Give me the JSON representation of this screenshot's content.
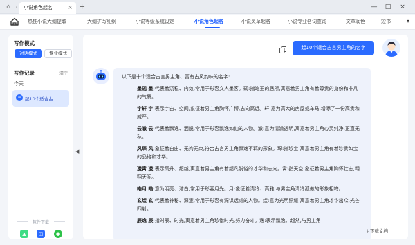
{
  "titlebar": {
    "tab_title": "小说角色起名",
    "close_symbol": "×",
    "plus_symbol": "+"
  },
  "window_controls": {
    "minimize": "—",
    "maximize": "□",
    "close": "×"
  },
  "nav": {
    "items": [
      {
        "label": "热梗小说大纲提取"
      },
      {
        "label": "大纲扩写细纲"
      },
      {
        "label": "小说等级系统设定"
      },
      {
        "label": "小说角色起名"
      },
      {
        "label": "小说灵草起名"
      },
      {
        "label": "小说专业名词查询"
      },
      {
        "label": "文章润色"
      },
      {
        "label": "短书"
      }
    ],
    "active_index": 3,
    "more_symbol": "▾"
  },
  "sidebar": {
    "mode_title": "写作模式",
    "mode_chat": "对话模式",
    "mode_pro": "专业模式",
    "record_title": "写作记录",
    "clear_label": "清空",
    "today_label": "今天",
    "records": [
      {
        "label": "起10个适合古..."
      }
    ],
    "download_label": "软件下载",
    "os_icons": [
      "android-icon",
      "windows-icon",
      "apple-icon"
    ]
  },
  "main": {
    "user_prompt": "起10个适合古言男主角的名字",
    "intro": "以下是十个适合古言男主角、富有古风韵味的名字:",
    "names": [
      {
        "name": "墨砚 墨",
        "desc": ":代表着沉稳、内敛,常用于形容文人墨客。砚:指笔王的居所,寓意着男主角有着尊贵的身份和非凡的气质。"
      },
      {
        "name": "宇轩 宇",
        "desc": ":表示宇宙、空间,象征着男主角胸怀广博,志向高远。轩:意为高大的房屋或车马,增添了一份高贵和威严。"
      },
      {
        "name": "云澈 云",
        "desc": ":代表着飘逸、洒脱,常用于形容飘逸如仙的人物。澈:意为清澈透明,寓意着男主角心灵纯净,正直无私。"
      },
      {
        "name": "风琛 风",
        "desc": ":象征着自由、无拘无束,符合古言男主角飘逸不羁的形象。琛:指珍宝,寓意着男主角有着珍贵如宝的品格和才华。"
      },
      {
        "name": "凌霄 凌",
        "desc": ":表示高升、超越,寓意着男主角有着超凡脱俗的才华和志向。霄:指天空,象征着男主角胸怀壮志,翱翔天际。"
      },
      {
        "name": "皓月 皓",
        "desc": ":意为明亮、洁白,常用于形容月光。月:象征着清冷、高雅,与男主角清冷孤傲的形象相符。"
      },
      {
        "name": "玄煜 玄",
        "desc": ":代表着神秘、深邃,常用于形容有深谋远虑的人物。煜:意为光明照耀,寓意着男主角才华出众,光芒四射。"
      },
      {
        "name": "辰逸 辰",
        "desc": ":指时辰、时光,寓意着男主角珍惜时光,努力奋斗。逸:表示飘逸、超然,与男主角"
      }
    ],
    "doc_button": "下载文档"
  },
  "colors": {
    "accent": "#2b6bff",
    "answer_bg": "#eef2fb",
    "app_bg": "#f3f5f9"
  }
}
